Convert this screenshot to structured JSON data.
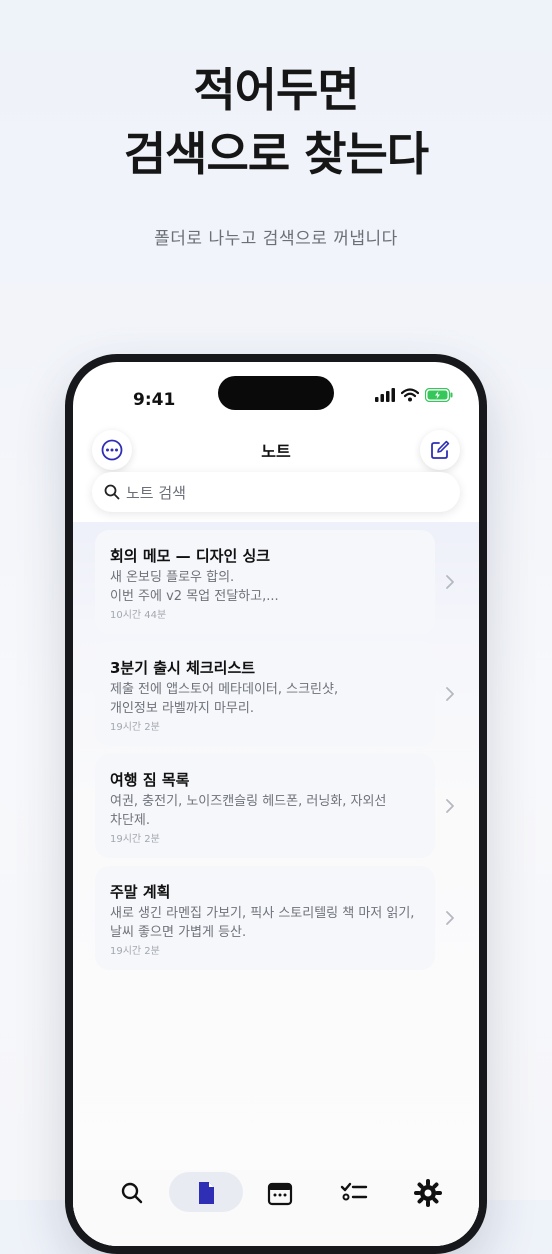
{
  "hero": {
    "headline_line1": "적어두면",
    "headline_line2": "검색으로 찾는다",
    "subtitle": "폴더로 나누고 검색으로 꺼냅니다"
  },
  "status_bar": {
    "time": "9:41"
  },
  "nav": {
    "title": "노트"
  },
  "search": {
    "placeholder": "노트 검색"
  },
  "notes": [
    {
      "title": "회의 메모 — 디자인 싱크",
      "line1": "새 온보딩 플로우 합의.",
      "line2": "이번 주에 v2 목업 전달하고,...",
      "time": "10시간 44분"
    },
    {
      "title": "3분기 출시 체크리스트",
      "line1": "제출 전에 앱스토어 메타데이터, 스크린샷,",
      "line2": "개인정보 라벨까지 마무리.",
      "time": "19시간 2분"
    },
    {
      "title": "여행 짐 목록",
      "line1": "여권, 충전기, 노이즈캔슬링 헤드폰, 러닝화, 자외선",
      "line2": "차단제.",
      "time": "19시간 2분"
    },
    {
      "title": "주말 계획",
      "line1": "새로 생긴 라멘집 가보기, 픽사 스토리텔링 책 마저 읽기,",
      "line2": "날씨 좋으면 가볍게 등산.",
      "time": "19시간 2분"
    }
  ],
  "colors": {
    "accent": "#2f2fb5",
    "battery": "#35c759"
  }
}
